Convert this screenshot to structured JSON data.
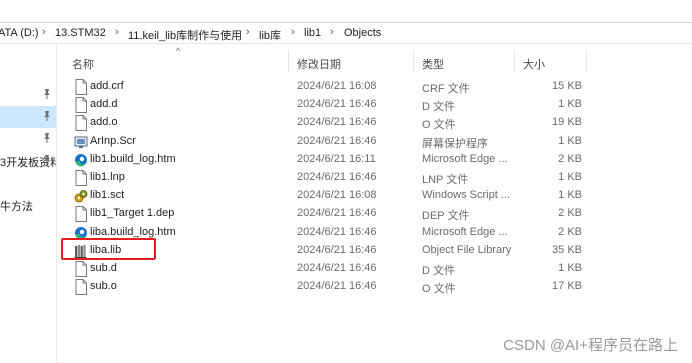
{
  "breadcrumb": {
    "items": [
      "ATA (D:)",
      "13.STM32",
      "11.keil_lib库制作与使用",
      "lib库",
      "lib1",
      "Objects"
    ],
    "separator": "›"
  },
  "nav": {
    "items": [
      {
        "label": ""
      },
      {
        "label": ""
      },
      {
        "label": ""
      },
      {
        "label": "3开发板资料"
      },
      {
        "label": ""
      },
      {
        "label": "牛方法"
      }
    ]
  },
  "columns": {
    "name": "名称",
    "date": "修改日期",
    "type": "类型",
    "size": "大小"
  },
  "files": [
    {
      "name": "add.crf",
      "date": "2024/6/21 16:08",
      "type": "CRF 文件",
      "size": "15 KB",
      "icon": "file-icon"
    },
    {
      "name": "add.d",
      "date": "2024/6/21 16:46",
      "type": "D 文件",
      "size": "1 KB",
      "icon": "file-icon"
    },
    {
      "name": "add.o",
      "date": "2024/6/21 16:46",
      "type": "O 文件",
      "size": "19 KB",
      "icon": "file-icon"
    },
    {
      "name": "ArInp.Scr",
      "date": "2024/6/21 16:46",
      "type": "屏幕保护程序",
      "size": "1 KB",
      "icon": "screensaver-icon"
    },
    {
      "name": "lib1.build_log.htm",
      "date": "2024/6/21 16:11",
      "type": "Microsoft Edge ...",
      "size": "2 KB",
      "icon": "edge-icon"
    },
    {
      "name": "lib1.lnp",
      "date": "2024/6/21 16:46",
      "type": "LNP 文件",
      "size": "1 KB",
      "icon": "file-icon"
    },
    {
      "name": "lib1.sct",
      "date": "2024/6/21 16:08",
      "type": "Windows Script ...",
      "size": "1 KB",
      "icon": "script-icon"
    },
    {
      "name": "lib1_Target 1.dep",
      "date": "2024/6/21 16:46",
      "type": "DEP 文件",
      "size": "2 KB",
      "icon": "file-icon"
    },
    {
      "name": "liba.build_log.htm",
      "date": "2024/6/21 16:46",
      "type": "Microsoft Edge ...",
      "size": "2 KB",
      "icon": "edge-icon"
    },
    {
      "name": "liba.lib",
      "date": "2024/6/21 16:46",
      "type": "Object File Library",
      "size": "35 KB",
      "icon": "library-icon"
    },
    {
      "name": "sub.d",
      "date": "2024/6/21 16:46",
      "type": "D 文件",
      "size": "1 KB",
      "icon": "file-icon"
    },
    {
      "name": "sub.o",
      "date": "2024/6/21 16:46",
      "type": "O 文件",
      "size": "17 KB",
      "icon": "file-icon"
    }
  ],
  "watermark": "CSDN @AI+程序员在路上",
  "colors": {
    "selected_nav": "#cce8ff",
    "highlight": "#e02020",
    "edge_blue": "#1a73c8",
    "edge_green": "#2eb872"
  }
}
